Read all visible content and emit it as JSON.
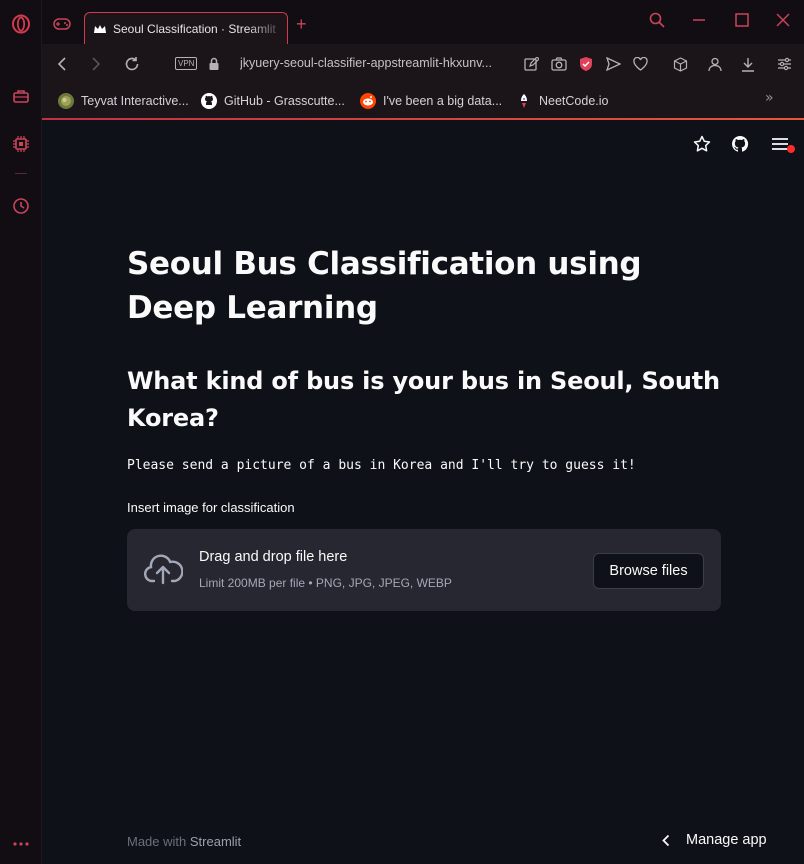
{
  "browser": {
    "tab_title": "Seoul Classification · Streamlit",
    "vpn_label": "VPN",
    "url": "jkyuery-seoul-classifier-appstreamlit-hkxunv...",
    "bookmarks": [
      {
        "label": "Teyvat Interactive...",
        "icon": "globe-icon"
      },
      {
        "label": "GitHub - Grasscutte...",
        "icon": "github-icon"
      },
      {
        "label": "I've been a big data...",
        "icon": "reddit-icon"
      },
      {
        "label": "NeetCode.io",
        "icon": "rocket-icon"
      }
    ],
    "bookmarks_more": "»",
    "accent_color": "#d23a4f"
  },
  "app": {
    "title": "Seoul Bus Classification using Deep Learning",
    "subtitle": "What kind of bus is your bus in Seoul, South Korea?",
    "instruction": "Please send a picture of a bus in Korea and I'll try to guess it!",
    "uploader": {
      "label": "Insert image for classification",
      "drop_text": "Drag and drop file here",
      "limit_text": "Limit 200MB per file • PNG, JPG, JPEG, WEBP",
      "browse_label": "Browse files"
    },
    "footer": {
      "made_with": "Made with",
      "brand": "Streamlit"
    },
    "manage_app": "Manage app"
  }
}
